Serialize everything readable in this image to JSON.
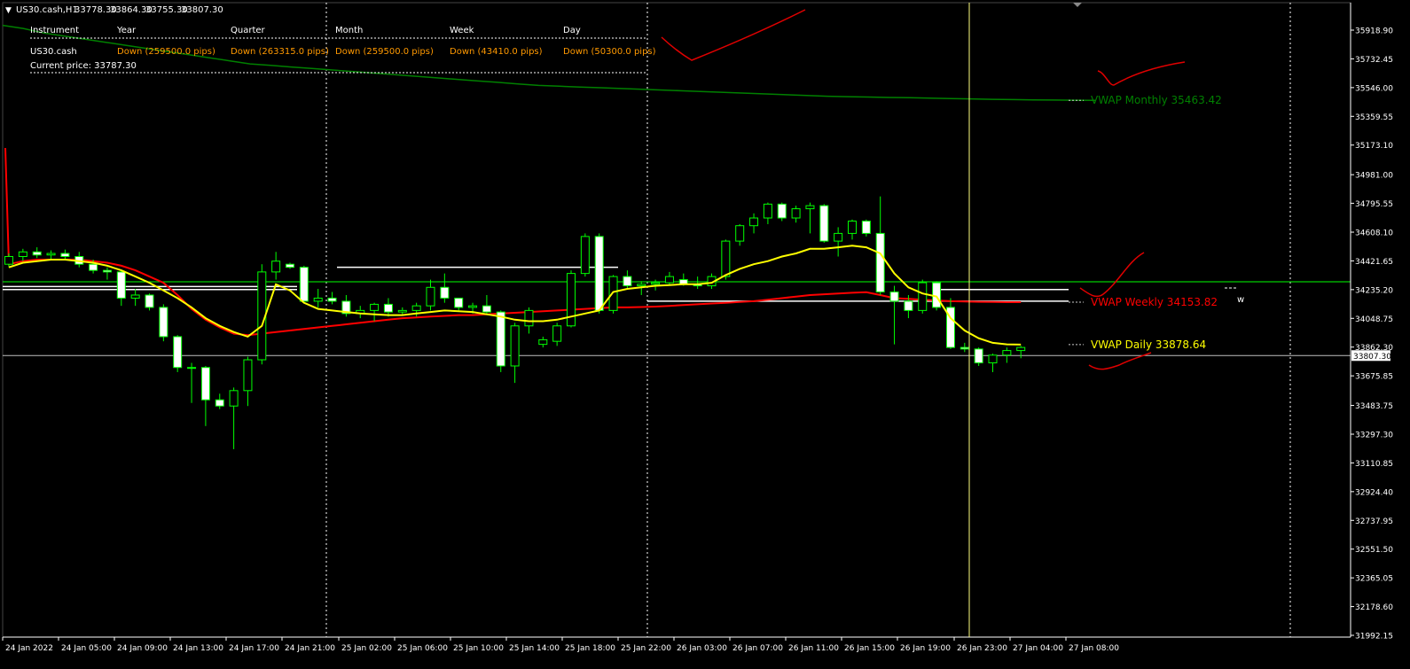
{
  "chart_window": {
    "title": "US30.cash,H1",
    "ohlc": [
      "33778.30",
      "33864.30",
      "33755.30",
      "33807.30"
    ]
  },
  "info_panel": {
    "headers": [
      "Instrument",
      "Year",
      "Quarter",
      "Month",
      "Week",
      "Day"
    ],
    "row": {
      "instrument": "US30.cash",
      "cells": [
        "Down (259500.0 pips)",
        "Down (263315.0 pips)",
        "Down (259500.0 pips)",
        "Down (43410.0 pips)",
        "Down (50300.0 pips)"
      ]
    },
    "current_price_label": "Current price: 33787.30"
  },
  "colors": {
    "background": "#000000",
    "candle_bull": "#000000",
    "candle_bear": "#ffffff",
    "candle_border": "#00ff00",
    "vwap_daily": "#ffff00",
    "vwap_weekly": "#ff0000",
    "vwap_monthly": "#008000",
    "info_header": "#ffffff",
    "info_value": "#ff9900",
    "grid_separator": "#ffffff",
    "current_price_line": "#c0c0c0",
    "crosshair": "#ffff80",
    "hline_green": "#00ff00"
  },
  "chart_data": {
    "type": "candlestick",
    "symbol": "US30.cash",
    "timeframe": "H1",
    "ylim": [
      31992.15,
      36000
    ],
    "y_ticks": [
      "35918.90",
      "35732.45",
      "35546.00",
      "35359.55",
      "35173.10",
      "34981.00",
      "34795.55",
      "34608.10",
      "34421.65",
      "34235.20",
      "34048.75",
      "33862.30",
      "33675.85",
      "33483.75",
      "33297.30",
      "33110.85",
      "32924.40",
      "32737.95",
      "32551.50",
      "32365.05",
      "32178.60",
      "31992.15"
    ],
    "x_ticks": [
      "24 Jan 2022",
      "24 Jan 05:00",
      "24 Jan 09:00",
      "24 Jan 13:00",
      "24 Jan 17:00",
      "24 Jan 21:00",
      "25 Jan 02:00",
      "25 Jan 06:00",
      "25 Jan 10:00",
      "25 Jan 14:00",
      "25 Jan 18:00",
      "25 Jan 22:00",
      "26 Jan 03:00",
      "26 Jan 07:00",
      "26 Jan 11:00",
      "26 Jan 15:00",
      "26 Jan 19:00",
      "26 Jan 23:00",
      "27 Jan 04:00",
      "27 Jan 08:00"
    ],
    "current_price": 33807.3,
    "current_price_label": "33807.30",
    "candles": [
      [
        34400,
        34470,
        34380,
        34450
      ],
      [
        34450,
        34500,
        34420,
        34480
      ],
      [
        34480,
        34510,
        34440,
        34460
      ],
      [
        34460,
        34490,
        34430,
        34470
      ],
      [
        34470,
        34495,
        34430,
        34450
      ],
      [
        34450,
        34480,
        34380,
        34400
      ],
      [
        34400,
        34430,
        34340,
        34360
      ],
      [
        34360,
        34380,
        34300,
        34350
      ],
      [
        34350,
        34360,
        34130,
        34180
      ],
      [
        34180,
        34240,
        34130,
        34200
      ],
      [
        34200,
        34210,
        34100,
        34120
      ],
      [
        34120,
        34140,
        33900,
        33930
      ],
      [
        33930,
        33940,
        33700,
        33730
      ],
      [
        33730,
        33760,
        33500,
        33730
      ],
      [
        33730,
        33740,
        33350,
        33520
      ],
      [
        33520,
        33560,
        33460,
        33480
      ],
      [
        33480,
        33600,
        33200,
        33580
      ],
      [
        33580,
        33800,
        33480,
        33780
      ],
      [
        33780,
        34400,
        33750,
        34350
      ],
      [
        34350,
        34480,
        34300,
        34420
      ],
      [
        34400,
        34410,
        34370,
        34380
      ],
      [
        34380,
        34390,
        34150,
        34160
      ],
      [
        34160,
        34240,
        34120,
        34180
      ],
      [
        34180,
        34220,
        34140,
        34160
      ],
      [
        34160,
        34200,
        34060,
        34080
      ],
      [
        34080,
        34130,
        34050,
        34100
      ],
      [
        34100,
        34150,
        34030,
        34140
      ],
      [
        34140,
        34180,
        34060,
        34090
      ],
      [
        34090,
        34120,
        34070,
        34100
      ],
      [
        34100,
        34150,
        34060,
        34130
      ],
      [
        34130,
        34300,
        34100,
        34250
      ],
      [
        34250,
        34340,
        34150,
        34180
      ],
      [
        34180,
        34180,
        34100,
        34120
      ],
      [
        34120,
        34150,
        34080,
        34130
      ],
      [
        34130,
        34200,
        34080,
        34090
      ],
      [
        34090,
        34100,
        33700,
        33740
      ],
      [
        33740,
        34020,
        33630,
        34000
      ],
      [
        34000,
        34120,
        33950,
        34100
      ],
      [
        33880,
        33930,
        33860,
        33910
      ],
      [
        33900,
        34020,
        33870,
        34000
      ],
      [
        34000,
        34360,
        33990,
        34340
      ],
      [
        34340,
        34600,
        34320,
        34580
      ],
      [
        34580,
        34600,
        34080,
        34100
      ],
      [
        34100,
        34330,
        34080,
        34320
      ],
      [
        34320,
        34360,
        34240,
        34260
      ],
      [
        34260,
        34290,
        34200,
        34270
      ],
      [
        34270,
        34300,
        34230,
        34280
      ],
      [
        34280,
        34350,
        34260,
        34320
      ],
      [
        34300,
        34340,
        34260,
        34270
      ],
      [
        34270,
        34320,
        34240,
        34260
      ],
      [
        34260,
        34340,
        34240,
        34320
      ],
      [
        34320,
        34560,
        34300,
        34550
      ],
      [
        34550,
        34660,
        34520,
        34650
      ],
      [
        34650,
        34730,
        34600,
        34700
      ],
      [
        34700,
        34800,
        34660,
        34790
      ],
      [
        34790,
        34800,
        34680,
        34700
      ],
      [
        34700,
        34780,
        34670,
        34760
      ],
      [
        34760,
        34800,
        34600,
        34780
      ],
      [
        34780,
        34790,
        34540,
        34550
      ],
      [
        34550,
        34640,
        34450,
        34600
      ],
      [
        34600,
        34690,
        34560,
        34680
      ],
      [
        34680,
        34690,
        34580,
        34600
      ],
      [
        34600,
        34840,
        34200,
        34220
      ],
      [
        34220,
        34260,
        33880,
        34160
      ],
      [
        34160,
        34200,
        34050,
        34100
      ],
      [
        34100,
        34300,
        34080,
        34280
      ],
      [
        34280,
        34290,
        34100,
        34120
      ],
      [
        34120,
        34180,
        33850,
        33860
      ],
      [
        33860,
        33890,
        33830,
        33850
      ],
      [
        33850,
        33860,
        33740,
        33760
      ],
      [
        33760,
        33820,
        33700,
        33810
      ],
      [
        33810,
        33860,
        33760,
        33840
      ],
      [
        33840,
        33870,
        33790,
        33860
      ]
    ],
    "vwap_daily_values": [
      34380,
      34410,
      34420,
      34430,
      34430,
      34420,
      34410,
      34390,
      34360,
      34320,
      34280,
      34230,
      34180,
      34120,
      34050,
      34000,
      33960,
      33930,
      34000,
      34270,
      34230,
      34150,
      34110,
      34100,
      34090,
      34080,
      34075,
      34070,
      34070,
      34080,
      34090,
      34100,
      34095,
      34090,
      34075,
      34060,
      34040,
      34030,
      34030,
      34040,
      34060,
      34080,
      34100,
      34220,
      34240,
      34250,
      34260,
      34265,
      34270,
      34270,
      34280,
      34330,
      34370,
      34400,
      34420,
      34450,
      34470,
      34500,
      34500,
      34510,
      34520,
      34510,
      34470,
      34340,
      34250,
      34210,
      34190,
      34050,
      33970,
      33920,
      33890,
      33880,
      33878.64
    ],
    "vwap_weekly_values": [
      34400,
      34420,
      34430,
      34430,
      34430,
      34430,
      34420,
      34410,
      34390,
      34360,
      34320,
      34280,
      34200,
      34110,
      34040,
      33990,
      33950,
      33940,
      33950,
      33960,
      33970,
      33980,
      33990,
      34000,
      34010,
      34020,
      34030,
      34040,
      34050,
      34055,
      34060,
      34065,
      34070,
      34070,
      34075,
      34080,
      34085,
      34090,
      34095,
      34100,
      34105,
      34110,
      34115,
      34120,
      34120,
      34122,
      34125,
      34130,
      34135,
      34140,
      34145,
      34150,
      34155,
      34160,
      34170,
      34180,
      34190,
      34200,
      34205,
      34210,
      34215,
      34218,
      34200,
      34180,
      34175,
      34170,
      34165,
      34160,
      34158,
      34156,
      34155,
      34154,
      34153.82
    ],
    "vwap_monthly_values": [
      35950,
      35930,
      35900,
      35880,
      35860,
      35840,
      35820,
      35800,
      35780,
      35760,
      35740,
      35720,
      35700,
      35690,
      35680,
      35670,
      35660,
      35650,
      35640,
      35630,
      35620,
      35610,
      35600,
      35590,
      35580,
      35570,
      35560,
      35555,
      35550,
      35545,
      35540,
      35535,
      35530,
      35525,
      35520,
      35515,
      35510,
      35505,
      35500,
      35495,
      35490,
      35487,
      35485,
      35482,
      35480,
      35478,
      35475,
      35473,
      35470,
      35468,
      35466,
      35465,
      35464,
      35463.42
    ],
    "vwap_labels": [
      {
        "text": "VWAP Monthly 35463.42",
        "value": 35463.42,
        "color": "#008000"
      },
      {
        "text": "VWAP Weekly 34153.82",
        "value": 34153.82,
        "color": "#ff0000"
      },
      {
        "text": "VWAP Daily 33878.64",
        "value": 33878.64,
        "color": "#ffff00"
      }
    ],
    "marker_w": "w",
    "horizontal_levels": [
      {
        "value": 34286,
        "color": "#00ff00"
      },
      {
        "value": 34255,
        "color": "#ffffff"
      },
      {
        "value": 34236,
        "color": "#ffffff"
      },
      {
        "value": 34160,
        "color": "#ffffff"
      },
      {
        "value": 34380,
        "color": "#ffffff"
      }
    ],
    "grid": false
  }
}
